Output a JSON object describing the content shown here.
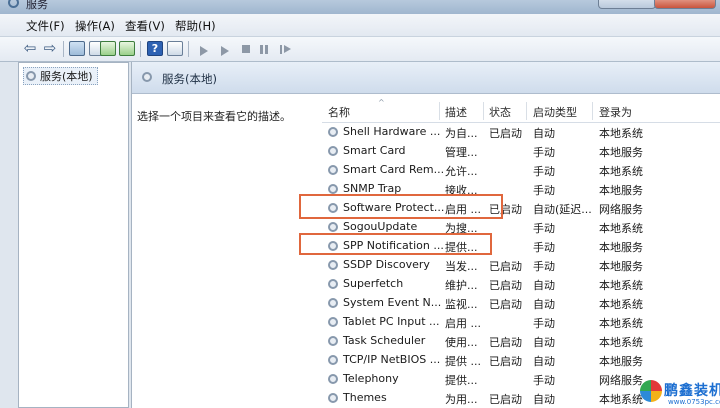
{
  "window": {
    "title": "服务"
  },
  "menu": [
    "文件(F)",
    "操作(A)",
    "查看(V)",
    "帮助(H)"
  ],
  "tree": {
    "root_label": "服务(本地)"
  },
  "pane": {
    "header_title": "服务(本地)",
    "description_hint": "选择一个项目来查看它的描述。"
  },
  "columns": {
    "name": "名称",
    "description": "描述",
    "status": "状态",
    "startup_type": "启动类型",
    "logon_as": "登录为"
  },
  "services": [
    {
      "name": "Shell Hardware ...",
      "description": "为自...",
      "status": "已启动",
      "startup": "自动",
      "logon": "本地系统"
    },
    {
      "name": "Smart Card",
      "description": "管理...",
      "status": "",
      "startup": "手动",
      "logon": "本地服务"
    },
    {
      "name": "Smart Card Rem...",
      "description": "允许...",
      "status": "",
      "startup": "手动",
      "logon": "本地系统"
    },
    {
      "name": "SNMP Trap",
      "description": "接收...",
      "status": "",
      "startup": "手动",
      "logon": "本地服务"
    },
    {
      "name": "Software Protect...",
      "description": "启用 ...",
      "status": "已启动",
      "startup": "自动(延迟...",
      "logon": "网络服务"
    },
    {
      "name": "SogouUpdate",
      "description": "为搜...",
      "status": "",
      "startup": "手动",
      "logon": "本地系统"
    },
    {
      "name": "SPP Notification ...",
      "description": "提供...",
      "status": "",
      "startup": "手动",
      "logon": "本地服务"
    },
    {
      "name": "SSDP Discovery",
      "description": "当发...",
      "status": "已启动",
      "startup": "手动",
      "logon": "本地服务"
    },
    {
      "name": "Superfetch",
      "description": "维护...",
      "status": "已启动",
      "startup": "自动",
      "logon": "本地系统"
    },
    {
      "name": "System Event N...",
      "description": "监视...",
      "status": "已启动",
      "startup": "自动",
      "logon": "本地系统"
    },
    {
      "name": "Tablet PC Input ...",
      "description": "启用 ...",
      "status": "",
      "startup": "手动",
      "logon": "本地系统"
    },
    {
      "name": "Task Scheduler",
      "description": "使用...",
      "status": "已启动",
      "startup": "自动",
      "logon": "本地系统"
    },
    {
      "name": "TCP/IP NetBIOS ...",
      "description": "提供 ...",
      "status": "已启动",
      "startup": "自动",
      "logon": "本地服务"
    },
    {
      "name": "Telephony",
      "description": "提供...",
      "status": "",
      "startup": "手动",
      "logon": "网络服务"
    },
    {
      "name": "Themes",
      "description": "为用...",
      "status": "已启动",
      "startup": "自动",
      "logon": "本地系统"
    }
  ],
  "watermark": {
    "brand": "鹏鑫装机网",
    "url": "www.0753pc.com"
  },
  "colors": {
    "highlight": "#e0673d",
    "header_bg": "#dbe5f1"
  }
}
